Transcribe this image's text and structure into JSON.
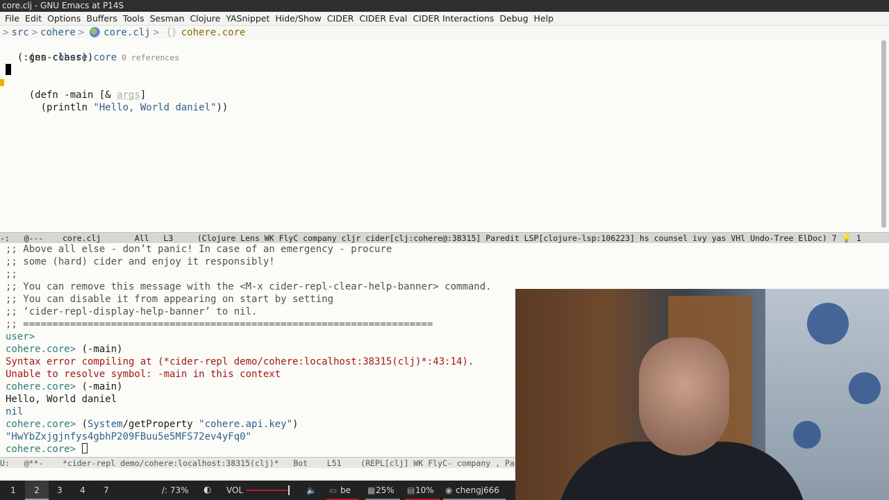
{
  "window": {
    "title": "core.clj - GNU Emacs at P14S"
  },
  "menu": [
    "File",
    "Edit",
    "Options",
    "Buffers",
    "Tools",
    "Sesman",
    "Clojure",
    "YASnippet",
    "Hide/Show",
    "CIDER",
    "CIDER Eval",
    "CIDER Interactions",
    "Debug",
    "Help"
  ],
  "breadcrumb": {
    "lead": ">",
    "parts": [
      "src",
      "cohere",
      "core.clj"
    ],
    "namespace": "cohere.core"
  },
  "editor": {
    "l1_a": "(ns ",
    "l1_b": "cohere.core",
    "l1_refs": " 0 references",
    "l2": "  (:gen-class))",
    "l4_a": "(defn -main [& ",
    "l4_b": "args",
    "l4_c": "]",
    "l5_a": "  (println ",
    "l5_b": "\"Hello, World daniel\"",
    "l5_c": "))"
  },
  "modeline_top": {
    "text": "-:   @---    core.clj       All   L3     (Clojure Lens WK FlyC company cljr cider[clj:cohere@:38315] Paredit LSP[clojure-lsp:106223] hs counsel ivy yas VHl Undo-Tree ElDoc) 7 ",
    "bulb": "💡",
    "tail": " 1"
  },
  "repl": {
    "c1": ";; Above all else - don’t panic! In case of an emergency - procure",
    "c2": ";; some (hard) cider and enjoy it responsibly!",
    "c3": ";;",
    "c4": ";; You can remove this message with the <M-x cider-repl-clear-help-banner> command.",
    "c5": ";; You can disable it from appearing on start by setting",
    "c6": ";; ‘cider-repl-display-help-banner’ to nil.",
    "c7": ";; ======================================================================",
    "user": "user>",
    "p1": "cohere.core> ",
    "i1": "(-main)",
    "e1": "Syntax error compiling at (*cider-repl demo/cohere:localhost:38315(clj)*:43:14).",
    "e2": "Unable to resolve symbol: -main in this context",
    "p2": "cohere.core> ",
    "i2": "(-main)",
    "o1": "Hello, World daniel",
    "nil": "nil",
    "p3": "cohere.core> ",
    "i3a": "(",
    "i3b": "System",
    "i3c": "/getProperty ",
    "i3d": "\"cohere.api.key\"",
    "i3e": ")",
    "r1": "\"HwYbZxjgjnfys4gbhP209FBuu5e5MFS72ev4yFq0\"",
    "p4": "cohere.core> "
  },
  "modeline_bottom": {
    "text": "U:   @**-    *cider-repl demo/cohere:localhost:38315(clj)*   Bot    L51    (REPL[clj] WK FlyC- company , Pa"
  },
  "taskbar": {
    "workspaces": [
      "1",
      "2",
      "3",
      "4",
      "7"
    ],
    "active_workspace": "2",
    "disk": "/: 73%",
    "vol_label": "VOL",
    "kb": "be",
    "cpu": "25%",
    "mem": "10%",
    "user": "chengj666"
  }
}
